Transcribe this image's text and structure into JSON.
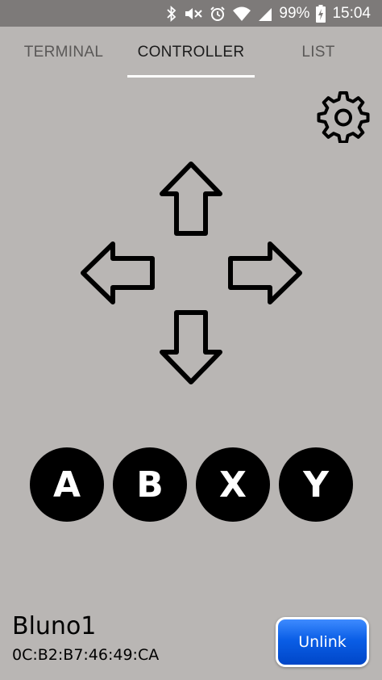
{
  "status_bar": {
    "battery": "99%",
    "time": "15:04",
    "icons": [
      "bluetooth-icon",
      "mute-icon",
      "alarm-icon",
      "wifi-icon",
      "signal-icon",
      "battery-charging-icon"
    ],
    "text_color": "#ffffff",
    "background": "#7d7a79"
  },
  "tabs": [
    {
      "label": "TERMINAL",
      "active": false
    },
    {
      "label": "CONTROLLER",
      "active": true
    },
    {
      "label": "LIST",
      "active": false
    }
  ],
  "controller": {
    "settings_icon": "gear-icon",
    "dpad": [
      "arrow-up-icon",
      "arrow-left-icon",
      "arrow-right-icon",
      "arrow-down-icon"
    ],
    "buttons": [
      "A",
      "B",
      "X",
      "Y"
    ]
  },
  "device": {
    "name": "Bluno1",
    "mac": "0C:B2:B7:46:49:CA"
  },
  "unlink_label": "Unlink",
  "colors": {
    "background": "#b9b6b4",
    "unlink_button": "#0a5ee6",
    "face_buttons": "#000000"
  }
}
